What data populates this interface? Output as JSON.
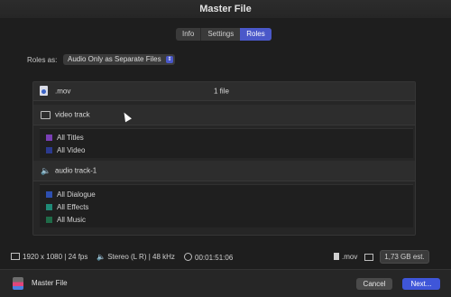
{
  "window": {
    "title": "Master File"
  },
  "tabs": [
    {
      "label": "Info",
      "active": false
    },
    {
      "label": "Settings",
      "active": false
    },
    {
      "label": "Roles",
      "active": true
    }
  ],
  "roles": {
    "label": "Roles as:",
    "selected": "Audio Only as Separate Files"
  },
  "file_row": {
    "name": ".mov",
    "count": "1 file",
    "icon": "file-icon"
  },
  "video_track": {
    "label": "video track",
    "icon": "film-icon",
    "roles": [
      {
        "label": "All Titles",
        "color": "#7a3fb5"
      },
      {
        "label": "All Video",
        "color": "#2b3a8f"
      }
    ]
  },
  "audio_track": {
    "label": "audio track-1",
    "icon": "speaker-icon",
    "roles": [
      {
        "label": "All Dialogue",
        "color": "#2d4fb0"
      },
      {
        "label": "All Effects",
        "color": "#1f8a77"
      },
      {
        "label": "All Music",
        "color": "#1f6b48"
      }
    ]
  },
  "footer": {
    "resolution": "1920 x 1080",
    "fps": "24 fps",
    "audio": "Stereo (L R)",
    "rate": "48 kHz",
    "duration": "00:01:51:06",
    "format": ".mov",
    "size": "1,73 GB est."
  },
  "bottom": {
    "title": "Master File",
    "cancel": "Cancel",
    "next": "Next..."
  },
  "colors": {
    "accent": "#4a58c9",
    "background": "#1e1e1e"
  }
}
